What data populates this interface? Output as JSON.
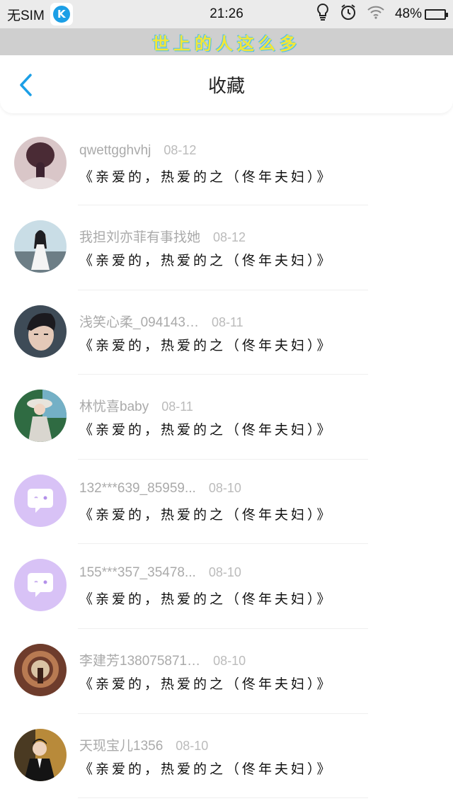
{
  "status_bar": {
    "carrier": "无SIM",
    "app_icon_letter": "K",
    "time": "21:26",
    "battery": "48%",
    "battery_level": 0.48,
    "icons": [
      "bulb-icon",
      "alarm-icon",
      "wifi-icon",
      "battery-icon"
    ]
  },
  "banner": {
    "text": "世上的人这么多"
  },
  "header": {
    "title": "收藏",
    "back_icon": "chevron-left-icon"
  },
  "colors": {
    "accent": "#1c9fe6",
    "banner_text": "#f3e637",
    "avatar_lavender": "#d8c2f6"
  },
  "favorites": [
    {
      "name": "qwettgghvhj",
      "date": "08-12",
      "content": "《亲爱的，热爱的之（佟年夫妇）》",
      "avatar": "photo-braid"
    },
    {
      "name": "我担刘亦菲有事找她",
      "date": "08-12",
      "content": "《亲爱的，热爱的之（佟年夫妇）》",
      "avatar": "photo-dress"
    },
    {
      "name": "浅笑心柔_094143…",
      "date": "08-11",
      "content": "《亲爱的，热爱的之（佟年夫妇）》",
      "avatar": "photo-boy"
    },
    {
      "name": "林忧喜baby",
      "date": "08-11",
      "content": "《亲爱的，热爱的之（佟年夫妇）》",
      "avatar": "photo-girl-hat"
    },
    {
      "name": "132***639_85959...",
      "date": "08-10",
      "content": "《亲爱的，热爱的之（佟年夫妇）》",
      "avatar": "default-chat"
    },
    {
      "name": "155***357_35478...",
      "date": "08-10",
      "content": "《亲爱的，热爱的之（佟年夫妇）》",
      "avatar": "default-chat"
    },
    {
      "name": "李建芳138075871…",
      "date": "08-10",
      "content": "《亲爱的，热爱的之（佟年夫妇）》",
      "avatar": "photo-arch"
    },
    {
      "name": "天现宝儿1356",
      "date": "08-10",
      "content": "《亲爱的，热爱的之（佟年夫妇）》",
      "avatar": "photo-suit"
    }
  ]
}
